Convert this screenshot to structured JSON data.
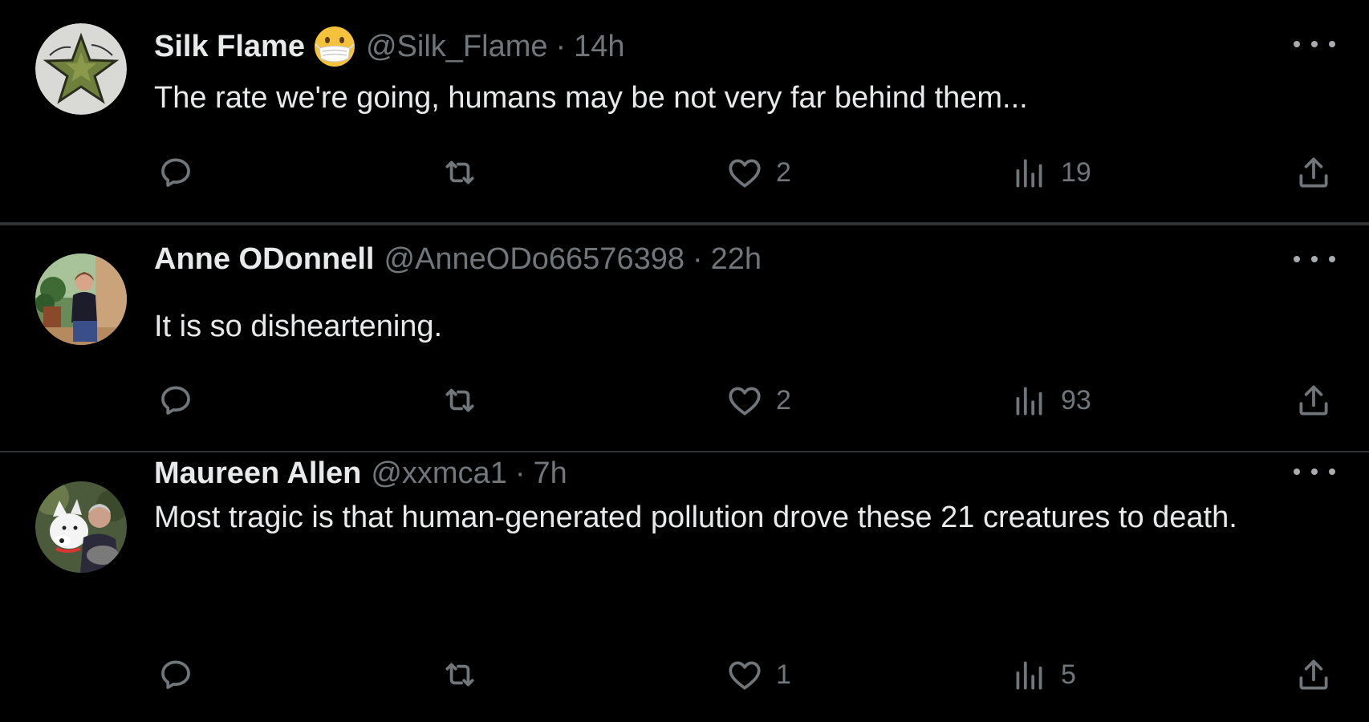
{
  "tweets": [
    {
      "name": "Silk Flame",
      "handle": "@Silk_Flame",
      "separator": "·",
      "time": "14h",
      "text": "The rate we're going, humans may be not very far behind them...",
      "likes": "2",
      "views": "19",
      "avatar_icon": "star-logo-icon",
      "badge_icon": "face-with-mask-emoji"
    },
    {
      "name": "Anne ODonnell",
      "handle": "@AnneODo66576398",
      "separator": "·",
      "time": "22h",
      "text": "It is so disheartening.",
      "likes": "2",
      "views": "93",
      "avatar_icon": "person-photo-avatar"
    },
    {
      "name": "Maureen Allen",
      "handle": "@xxmca1",
      "separator": "·",
      "time": "7h",
      "text": "Most tragic is that human-generated pollution drove these 21 creatures to death.",
      "likes": "1",
      "views": "5",
      "avatar_icon": "person-with-dog-photo-avatar"
    }
  ],
  "colors": {
    "background": "#000000",
    "primary_text": "#e7e9ea",
    "secondary_text": "#71767b",
    "divider": "#2f3336"
  }
}
